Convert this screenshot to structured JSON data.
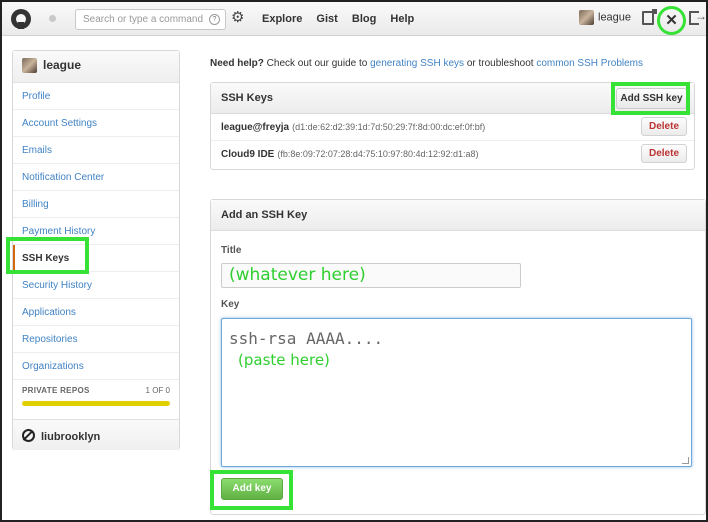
{
  "header": {
    "search_placeholder": "Search or type a command",
    "search_help": "?",
    "nav": [
      "Explore",
      "Gist",
      "Blog",
      "Help"
    ],
    "username": "league",
    "icons": [
      "github-logo-icon",
      "notification-dot-icon",
      "gear-icon",
      "news-feed-icon",
      "account-settings-tools-icon",
      "logout-icon"
    ]
  },
  "sidebar": {
    "account": "league",
    "items": [
      {
        "label": "Profile"
      },
      {
        "label": "Account Settings"
      },
      {
        "label": "Emails"
      },
      {
        "label": "Notification Center"
      },
      {
        "label": "Billing"
      },
      {
        "label": "Payment History"
      },
      {
        "label": "SSH Keys",
        "active": true
      },
      {
        "label": "Security History"
      },
      {
        "label": "Applications"
      },
      {
        "label": "Repositories"
      },
      {
        "label": "Organizations"
      }
    ],
    "private_repos": {
      "label": "PRIVATE REPOS",
      "count": "1 OF 0",
      "fill_fraction": 1.0
    },
    "org": "liubrooklyn"
  },
  "help": {
    "prefix": "Need help?",
    "text1": " Check out our guide to ",
    "link1": "generating SSH keys",
    "text2": " or troubleshoot ",
    "link2": "common SSH Problems"
  },
  "ssh_keys": {
    "title": "SSH Keys",
    "add_button": "Add SSH key",
    "delete_label": "Delete",
    "keys": [
      {
        "name": "league@freyja",
        "fingerprint": "(d1:de:62:d2:39:1d:7d:50:29:7f:8d:00:dc:ef:0f:bf)"
      },
      {
        "name": "Cloud9 IDE",
        "fingerprint": "(fb:8e:09:72:07:28:d4:75:10:97:80:4d:12:92:d1:a8)"
      }
    ]
  },
  "add_key": {
    "title": "Add an SSH Key",
    "title_label": "Title",
    "title_value": "(whatever here)",
    "key_label": "Key",
    "key_value_line1": "ssh-rsa AAAA....",
    "key_value_line2": "(paste here)",
    "submit": "Add key"
  },
  "colors": {
    "highlight": "#35e235",
    "link": "#4183c4",
    "active_marker": "#d26911",
    "submit_green": "#60b044"
  }
}
